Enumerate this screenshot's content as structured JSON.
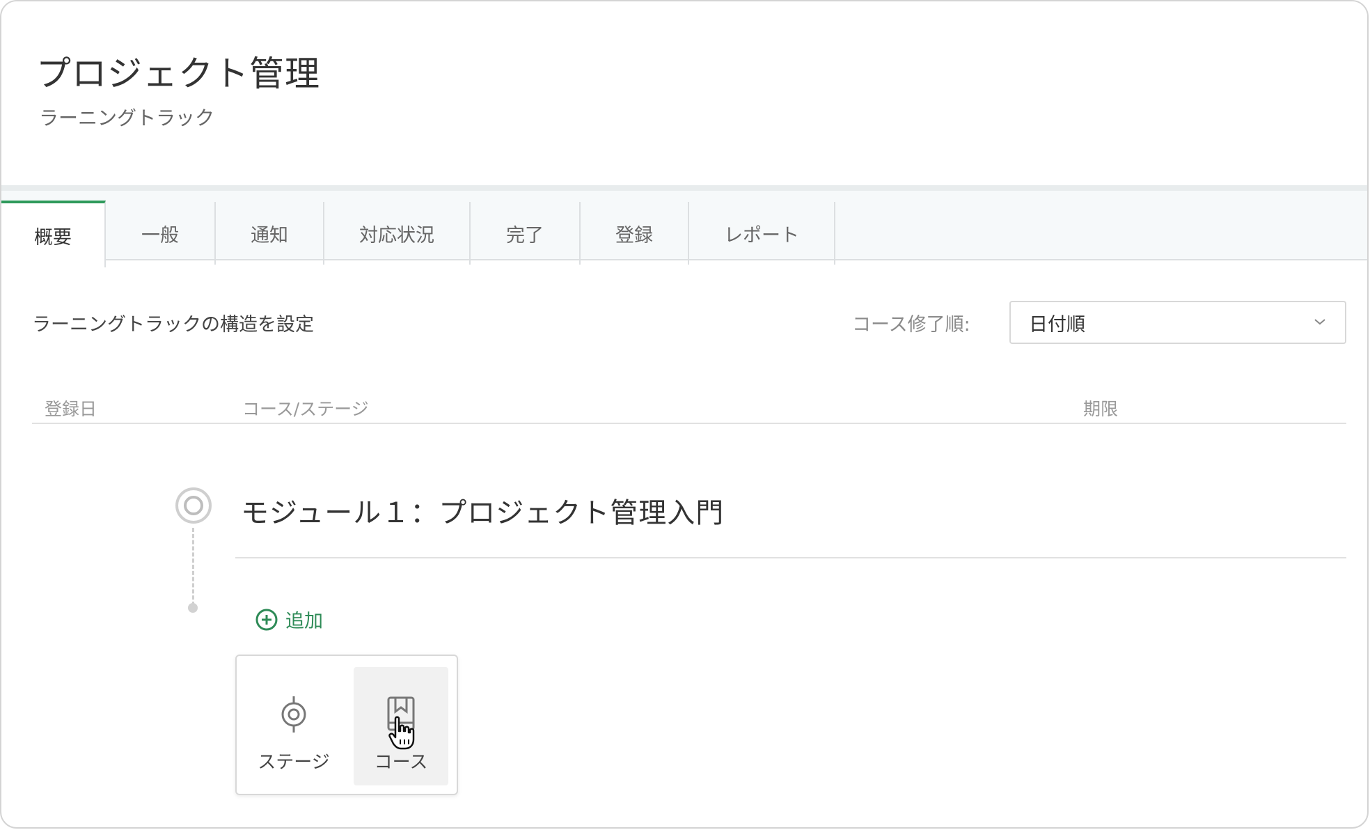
{
  "header": {
    "title": "プロジェクト管理",
    "subtitle": "ラーニングトラック"
  },
  "tabs": [
    {
      "label": "概要",
      "active": true
    },
    {
      "label": "一般",
      "active": false
    },
    {
      "label": "通知",
      "active": false
    },
    {
      "label": "対応状況",
      "active": false
    },
    {
      "label": "完了",
      "active": false
    },
    {
      "label": "登録",
      "active": false
    },
    {
      "label": "レポート",
      "active": false
    }
  ],
  "structure": {
    "section_label": "ラーニングトラックの構造を設定",
    "order_label": "コース修了順:",
    "order_select_value": "日付順"
  },
  "table": {
    "headers": {
      "registered": "登録日",
      "course_stage": "コース/ステージ",
      "deadline": "期限"
    }
  },
  "module": {
    "title": "モジュール１：プロジェクト管理入門",
    "add_label": "追加"
  },
  "add_menu": {
    "stage_label": "ステージ",
    "course_label": "コース"
  },
  "colors": {
    "accent": "#2e9a5b",
    "add_text": "#2e8b57"
  },
  "icons": {
    "stage": "target-icon",
    "course": "book-icon",
    "add": "plus-circle-icon",
    "select": "chevron-down-icon",
    "cursor": "hand-pointer-icon"
  }
}
